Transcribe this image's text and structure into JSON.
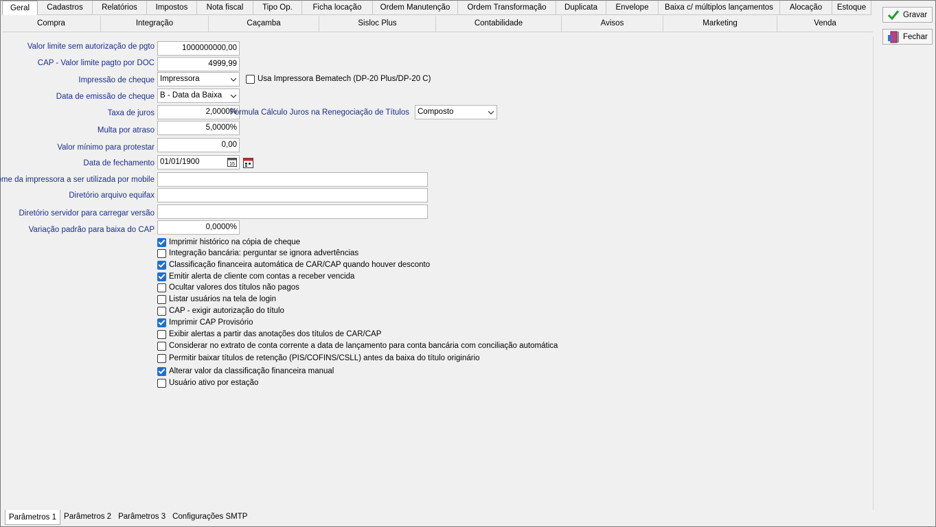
{
  "tabs_row1": [
    "Geral",
    "Cadastros",
    "Relatórios",
    "Impostos",
    "Nota fiscal",
    "Tipo Op.",
    "Ficha locação",
    "Ordem Manutenção",
    "Ordem Transformação",
    "Duplicata",
    "Envelope",
    "Baixa c/ múltiplos lançamentos",
    "Alocação",
    "Estoque"
  ],
  "tabs_row2": [
    "Compra",
    "Integração",
    "Caçamba",
    "Sisloc Plus",
    "Contabilidade",
    "Avisos",
    "Marketing",
    "Venda"
  ],
  "buttons": {
    "save": "Gravar",
    "close": "Fechar"
  },
  "form": {
    "limite_sem_autorizacao": {
      "label": "Valor limite sem autorização de pgto",
      "value": "1000000000,00"
    },
    "cap_limite_doc": {
      "label": "CAP - Valor limite pagto por DOC",
      "value": "4999,99"
    },
    "impressao_cheque": {
      "label": "Impressão de cheque",
      "value": "Impressora"
    },
    "usa_bematech": {
      "label": "Usa Impressora Bematech (DP-20 Plus/DP-20 C)",
      "checked": false
    },
    "data_emissao_cheque": {
      "label": "Data de emissão de cheque",
      "value": "B - Data da Baixa"
    },
    "taxa_juros": {
      "label": "Taxa de juros",
      "value": "2,0000%"
    },
    "formula_juros": {
      "label": "Fórmula Cálculo Juros na Renegociação de Títulos",
      "value": "Composto"
    },
    "multa_atraso": {
      "label": "Multa por atraso",
      "value": "5,0000%"
    },
    "valor_min_protestar": {
      "label": "Valor mínimo para protestar",
      "value": "0,00"
    },
    "data_fechamento": {
      "label": "Data de fechamento",
      "value": "01/01/1900"
    },
    "nome_impressora_mobile": {
      "label": "Nome da impressora a ser utilizada por mobile",
      "value": ""
    },
    "diretorio_equifax": {
      "label": "Diretório arquivo equifax",
      "value": ""
    },
    "diretorio_servidor": {
      "label": "Diretório servidor para carregar versão",
      "value": ""
    },
    "variacao_baixa_cap": {
      "label": "Variação padrão para baixa do CAP",
      "value": "0,0000%"
    }
  },
  "checkboxes": [
    {
      "label": "Imprimir histórico na cópia de cheque",
      "checked": true
    },
    {
      "label": "Integração bancária: perguntar se ignora advertências",
      "checked": false
    },
    {
      "label": "Classificação financeira automática de CAR/CAP quando houver desconto",
      "checked": true
    },
    {
      "label": "Emitir alerta de cliente com contas a receber vencida",
      "checked": true
    },
    {
      "label": "Ocultar valores dos títulos não pagos",
      "checked": false
    },
    {
      "label": "Listar usuários na tela de login",
      "checked": false
    },
    {
      "label": "CAP - exigir autorização do título",
      "checked": false
    },
    {
      "label": "Imprimir CAP Provisório",
      "checked": true
    },
    {
      "label": "Exibir alertas a partir das anotações dos títulos de CAR/CAP",
      "checked": false
    },
    {
      "label": "Considerar no extrato de conta corrente a data de lançamento para conta bancária com conciliação automática",
      "checked": false
    },
    {
      "label": "Permitir baixar títulos de retenção (PIS/COFINS/CSLL) antes da baixa do título originário",
      "checked": false
    },
    {
      "label": "Alterar valor da classificação financeira manual",
      "checked": true
    },
    {
      "label": "Usuário ativo por estação",
      "checked": false
    }
  ],
  "bottom_tabs": [
    "Parâmetros 1",
    "Parâmetros 2",
    "Parâmetros 3",
    "Configurações SMTP"
  ],
  "icons": {
    "save": "check-icon",
    "close": "door-exit-icon",
    "calendar": "calendar-icon"
  },
  "colors": {
    "label_blue": "#1a2f8a",
    "check_blue": "#1e6fd0",
    "save_green": "#1f9e2c"
  }
}
